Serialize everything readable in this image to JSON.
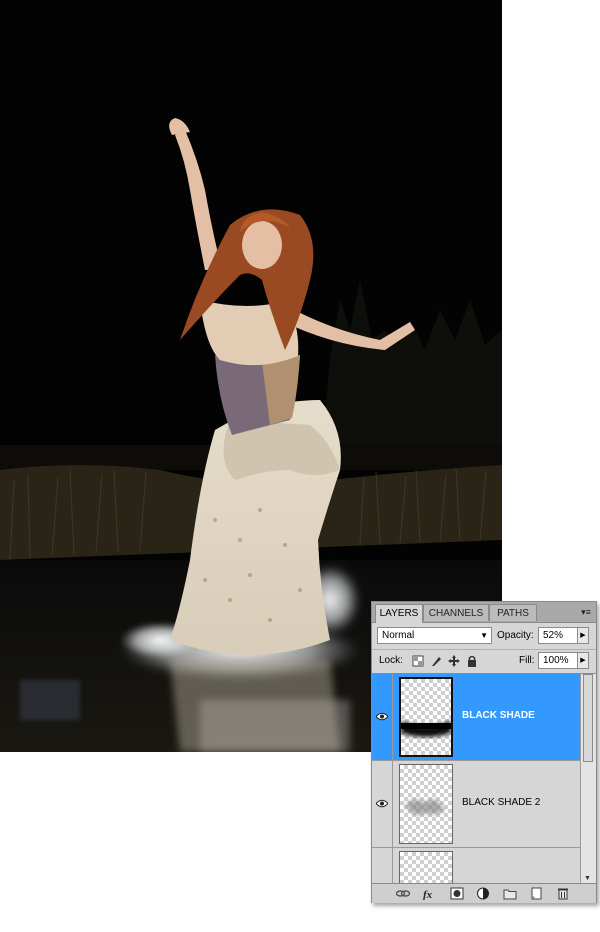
{
  "panel": {
    "tabs": [
      {
        "label": "LAYERS",
        "active": true
      },
      {
        "label": "CHANNELS",
        "active": false
      },
      {
        "label": "PATHS",
        "active": false
      }
    ],
    "menu_icon": "panel-menu-icon",
    "blend_mode": "Normal",
    "opacity_label": "Opacity:",
    "opacity_value": "52%",
    "lock_label": "Lock:",
    "fill_label": "Fill:",
    "fill_value": "100%",
    "layers": [
      {
        "name": "BLACK SHADE",
        "selected": true,
        "visible": true
      },
      {
        "name": "BLACK SHADE 2",
        "selected": false,
        "visible": true
      },
      {
        "name": "",
        "selected": false,
        "visible": false
      }
    ],
    "bottom_icons": [
      "link-icon",
      "fx-icon",
      "mask-icon",
      "adjustment-icon",
      "group-icon",
      "new-layer-icon",
      "trash-icon"
    ],
    "colors": {
      "selection": "#3399ff",
      "panel_bg": "#d6d6d6"
    }
  }
}
